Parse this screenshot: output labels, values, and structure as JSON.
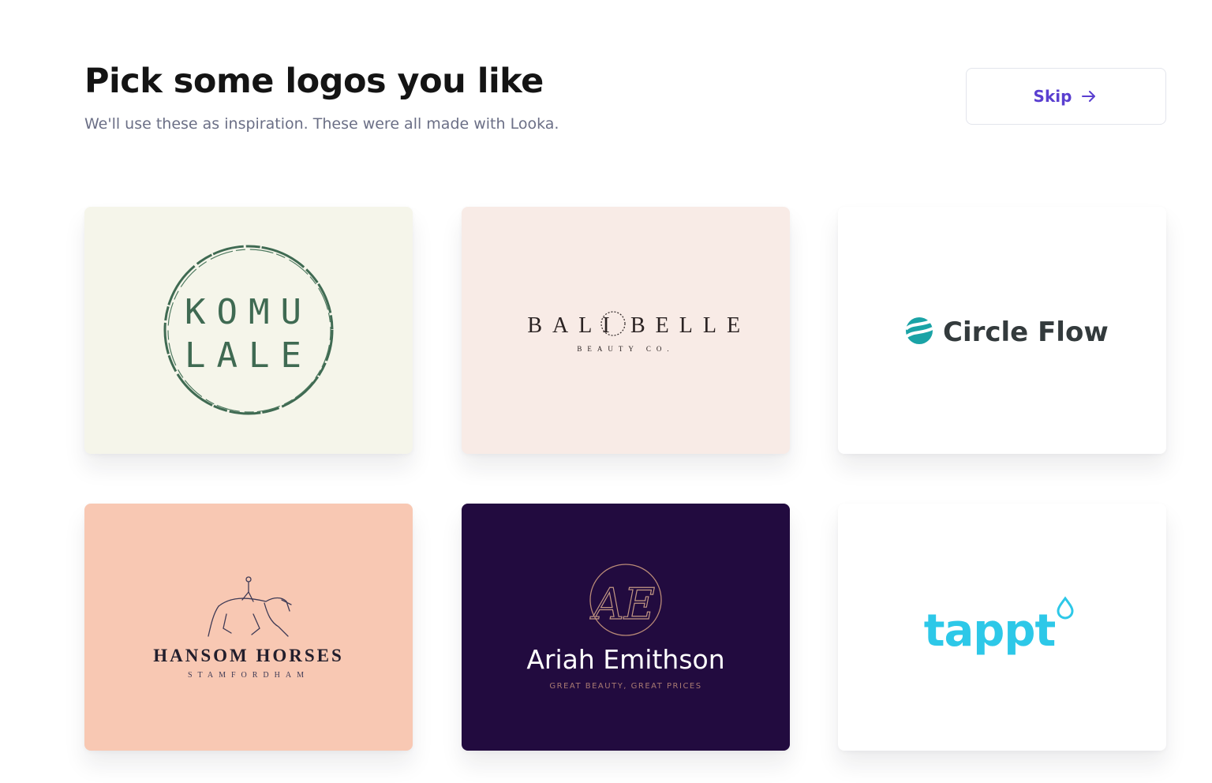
{
  "header": {
    "title": "Pick some logos you like",
    "subtitle": "We'll use these as inspiration. These were all made with Looka.",
    "skip_label": "Skip",
    "skip_icon": "arrow-right-icon"
  },
  "colors": {
    "accent": "#5a3fd0",
    "card_komu_bg": "#f5f5ea",
    "card_bali_bg": "#f8ebe6",
    "card_circle_bg": "#ffffff",
    "card_hansom_bg": "#f8c8b3",
    "card_ariah_bg": "#220b3f",
    "card_tappt_bg": "#ffffff"
  },
  "logos": [
    {
      "name": "komu-lale",
      "line1": "KOMU",
      "line2": "LALE"
    },
    {
      "name": "bali-belle",
      "word1": "BALI",
      "word2": "BELLE",
      "tagline": "BEAUTY CO."
    },
    {
      "name": "circle-flow",
      "text": "Circle Flow"
    },
    {
      "name": "hansom-horses",
      "text": "HANSOM HORSES",
      "tagline": "STAMFORDHAM"
    },
    {
      "name": "ariah-emithson",
      "monogram": "AE",
      "text": "Ariah Emithson",
      "tagline": "GREAT BEAUTY, GREAT PRICES"
    },
    {
      "name": "tappt",
      "text": "tappt"
    }
  ]
}
